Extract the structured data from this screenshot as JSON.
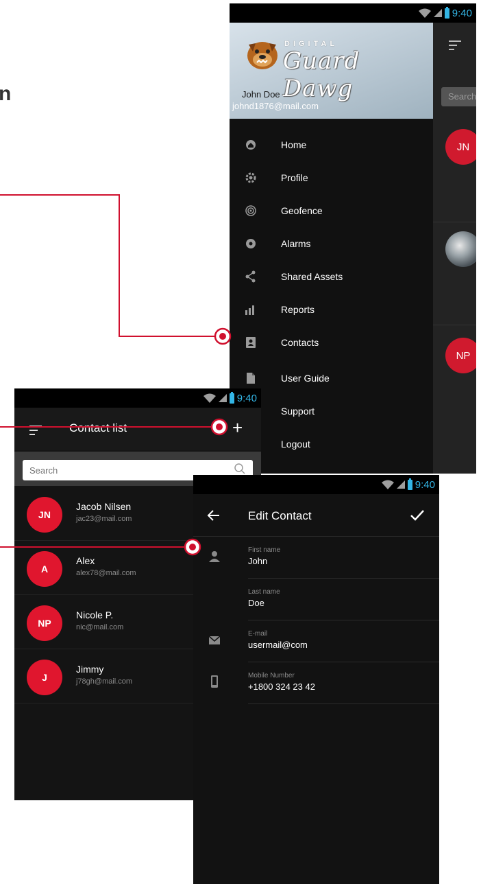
{
  "page": {
    "partial_letter": "n"
  },
  "status_bar": {
    "time": "9:40"
  },
  "drawer_screen": {
    "brand_small": "DIGITAL",
    "brand_main": "Guard Dawg",
    "user_name": "John Doe",
    "user_email": "johnd1876@mail.com",
    "background_search_placeholder": "Search",
    "background_avatars": [
      "JN",
      "NP"
    ],
    "menu": [
      {
        "label": "Home",
        "icon": "home-icon"
      },
      {
        "label": "Profile",
        "icon": "gear-icon"
      },
      {
        "label": "Geofence",
        "icon": "target-icon"
      },
      {
        "label": "Alarms",
        "icon": "alarm-icon"
      },
      {
        "label": "Shared Assets",
        "icon": "share-icon"
      },
      {
        "label": "Reports",
        "icon": "bar-chart-icon"
      },
      {
        "label": "Contacts",
        "icon": "contacts-icon"
      },
      {
        "label": "User Guide",
        "icon": "document-icon"
      },
      {
        "label": "Support",
        "icon": "support-icon"
      },
      {
        "label": "Logout",
        "icon": "logout-icon"
      }
    ]
  },
  "contact_list_screen": {
    "title": "Contact list",
    "search_placeholder": "Search",
    "contacts": [
      {
        "initials": "JN",
        "name": "Jacob Nilsen",
        "email": "jac23@mail.com"
      },
      {
        "initials": "A",
        "name": "Alex",
        "email": "alex78@mail.com"
      },
      {
        "initials": "NP",
        "name": "Nicole P.",
        "email": "nic@mail.com"
      },
      {
        "initials": "J",
        "name": "Jimmy",
        "email": "j78gh@mail.com"
      }
    ]
  },
  "edit_contact_screen": {
    "title": "Edit Contact",
    "fields": [
      {
        "label": "First name",
        "value": "John",
        "icon": "person-icon"
      },
      {
        "label": "Last name",
        "value": "Doe",
        "icon": ""
      },
      {
        "label": "E-mail",
        "value": "usermail@com",
        "icon": "mail-icon"
      },
      {
        "label": "Mobile Number",
        "value": "+1800 324 23 42",
        "icon": "phone-icon"
      }
    ]
  },
  "colors": {
    "accent_red": "#d0102e",
    "status_blue": "#33b5e5",
    "background_dark": "#111111"
  }
}
